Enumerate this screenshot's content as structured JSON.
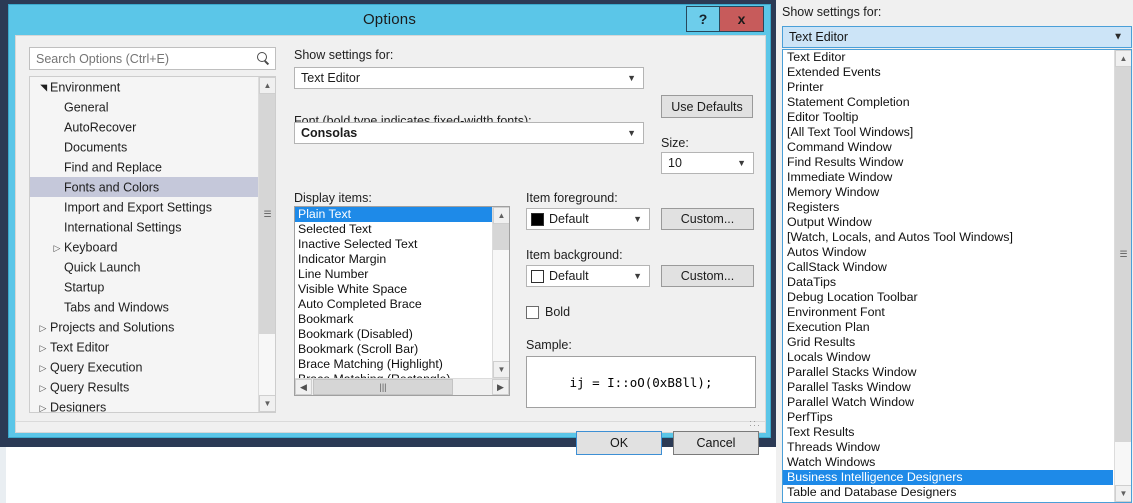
{
  "dialog": {
    "title": "Options",
    "help_button": "?",
    "close_button": "x",
    "search": {
      "placeholder": "Search Options (Ctrl+E)",
      "value": ""
    },
    "tree": [
      {
        "label": "Environment",
        "level": 0,
        "twisty": "open",
        "selected": false
      },
      {
        "label": "General",
        "level": 1,
        "twisty": "none",
        "selected": false
      },
      {
        "label": "AutoRecover",
        "level": 1,
        "twisty": "none",
        "selected": false
      },
      {
        "label": "Documents",
        "level": 1,
        "twisty": "none",
        "selected": false
      },
      {
        "label": "Find and Replace",
        "level": 1,
        "twisty": "none",
        "selected": false
      },
      {
        "label": "Fonts and Colors",
        "level": 1,
        "twisty": "none",
        "selected": true
      },
      {
        "label": "Import and Export Settings",
        "level": 1,
        "twisty": "none",
        "selected": false
      },
      {
        "label": "International Settings",
        "level": 1,
        "twisty": "none",
        "selected": false
      },
      {
        "label": "Keyboard",
        "level": 1,
        "twisty": "collapsed",
        "selected": false
      },
      {
        "label": "Quick Launch",
        "level": 1,
        "twisty": "none",
        "selected": false
      },
      {
        "label": "Startup",
        "level": 1,
        "twisty": "none",
        "selected": false
      },
      {
        "label": "Tabs and Windows",
        "level": 1,
        "twisty": "none",
        "selected": false
      },
      {
        "label": "Projects and Solutions",
        "level": 0,
        "twisty": "collapsed",
        "selected": false
      },
      {
        "label": "Text Editor",
        "level": 0,
        "twisty": "collapsed",
        "selected": false
      },
      {
        "label": "Query Execution",
        "level": 0,
        "twisty": "collapsed",
        "selected": false
      },
      {
        "label": "Query Results",
        "level": 0,
        "twisty": "collapsed",
        "selected": false
      },
      {
        "label": "Designers",
        "level": 0,
        "twisty": "collapsed",
        "selected": false
      }
    ],
    "show_settings_for": {
      "label": "Show settings for:",
      "value": "Text Editor"
    },
    "use_defaults_button": "Use Defaults",
    "font": {
      "label": "Font (bold type indicates fixed-width fonts):",
      "value": "Consolas"
    },
    "size": {
      "label": "Size:",
      "value": "10"
    },
    "display_items": {
      "label": "Display items:",
      "items": [
        {
          "label": "Plain Text",
          "selected": true
        },
        {
          "label": "Selected Text",
          "selected": false
        },
        {
          "label": "Inactive Selected Text",
          "selected": false
        },
        {
          "label": "Indicator Margin",
          "selected": false
        },
        {
          "label": "Line Number",
          "selected": false
        },
        {
          "label": "Visible White Space",
          "selected": false
        },
        {
          "label": "Auto Completed Brace",
          "selected": false
        },
        {
          "label": "Bookmark",
          "selected": false
        },
        {
          "label": "Bookmark (Disabled)",
          "selected": false
        },
        {
          "label": "Bookmark (Scroll Bar)",
          "selected": false
        },
        {
          "label": "Brace Matching (Highlight)",
          "selected": false
        },
        {
          "label": "Brace Matching (Rectangle)",
          "selected": false
        }
      ]
    },
    "item_foreground": {
      "label": "Item foreground:",
      "value": "Default",
      "swatch_color": "#000000",
      "custom_button": "Custom..."
    },
    "item_background": {
      "label": "Item background:",
      "value": "Default",
      "swatch_color": "#ffffff",
      "custom_button": "Custom..."
    },
    "bold_checkbox": {
      "label": "Bold",
      "checked": false
    },
    "sample": {
      "label": "Sample:",
      "text": "ij = I::oO(0xB8ll);"
    },
    "ok_button": "OK",
    "cancel_button": "Cancel"
  },
  "right_panel": {
    "label": "Show settings for:",
    "selected_value": "Text Editor",
    "items": [
      {
        "label": "Text Editor",
        "selected": false
      },
      {
        "label": "Extended Events",
        "selected": false
      },
      {
        "label": "Printer",
        "selected": false
      },
      {
        "label": "Statement Completion",
        "selected": false
      },
      {
        "label": "Editor Tooltip",
        "selected": false
      },
      {
        "label": "[All Text Tool Windows]",
        "selected": false
      },
      {
        "label": "Command Window",
        "selected": false
      },
      {
        "label": "Find Results Window",
        "selected": false
      },
      {
        "label": "Immediate Window",
        "selected": false
      },
      {
        "label": "Memory Window",
        "selected": false
      },
      {
        "label": "Registers",
        "selected": false
      },
      {
        "label": "Output Window",
        "selected": false
      },
      {
        "label": "[Watch, Locals, and Autos Tool Windows]",
        "selected": false
      },
      {
        "label": "Autos Window",
        "selected": false
      },
      {
        "label": "CallStack Window",
        "selected": false
      },
      {
        "label": "DataTips",
        "selected": false
      },
      {
        "label": "Debug Location Toolbar",
        "selected": false
      },
      {
        "label": "Environment Font",
        "selected": false
      },
      {
        "label": "Execution Plan",
        "selected": false
      },
      {
        "label": "Grid Results",
        "selected": false
      },
      {
        "label": "Locals Window",
        "selected": false
      },
      {
        "label": "Parallel Stacks Window",
        "selected": false
      },
      {
        "label": "Parallel Tasks Window",
        "selected": false
      },
      {
        "label": "Parallel Watch Window",
        "selected": false
      },
      {
        "label": "PerfTips",
        "selected": false
      },
      {
        "label": "Text Results",
        "selected": false
      },
      {
        "label": "Threads Window",
        "selected": false
      },
      {
        "label": "Watch Windows",
        "selected": false
      },
      {
        "label": "Business Intelligence Designers",
        "selected": true
      },
      {
        "label": "Table and Database Designers",
        "selected": false
      }
    ]
  },
  "colors": {
    "titlebar": "#5bc6e8",
    "close_button": "#c75b5b",
    "selection_blue": "#1e8ae8",
    "tree_selection": "#c5c8da",
    "combo_highlight": "#cce4f7",
    "backdrop_navy": "#2b3a55"
  }
}
